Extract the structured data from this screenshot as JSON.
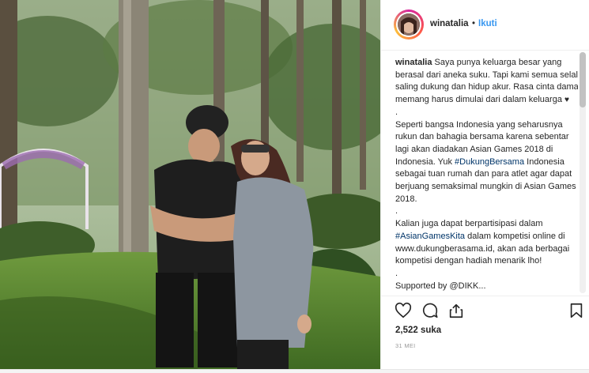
{
  "post": {
    "username": "winatalia",
    "dot": "•",
    "follow_label": "Ikuti",
    "caption": {
      "author": "winatalia",
      "p1": "Saya punya keluarga besar yang berasal dari aneka suku. Tapi kami semua selalu saling dukung dan hidup akur. Rasa cinta damai memang harus dimulai dari dalam keluarga",
      "heart": "♥",
      "sep1": ".",
      "p2a": "Seperti bangsa Indonesia yang seharusnya rukun dan bahagia bersama karena sebentar lagi akan diadakan Asian Games 2018 di Indonesia. Yuk",
      "hashtag1": "#DukungBersama",
      "p2b": "Indonesia sebagai tuan rumah dan para atlet agar dapat berjuang semaksimal mungkin di Asian Games 2018.",
      "sep2": ".",
      "p3a": "Kalian juga dapat berpartisipasi dalam",
      "hashtag2": "#AsianGamesKita",
      "p3b": "dalam kompetisi online di www.dukungberasama.id, akan ada berbagai kompetisi dengan hadiah menarik lho!",
      "sep3": ".",
      "p4": "Supported by @DIKK..."
    },
    "likes": "2,522 suka",
    "date": "31 MEI"
  },
  "icons": {
    "like": "heart-outline-icon",
    "comment": "comment-bubble-icon",
    "share": "share-icon",
    "save": "bookmark-icon"
  },
  "colors": {
    "link": "#3897f0",
    "hashtag": "#003569",
    "text": "#262626",
    "muted": "#999999"
  }
}
